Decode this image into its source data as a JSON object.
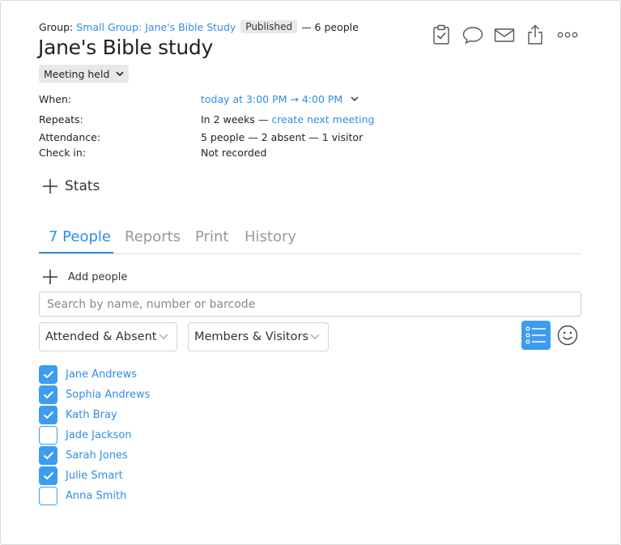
{
  "header": {
    "group_prefix": "Group:",
    "group_link": "Small Group: Jane's Bible Study",
    "status_badge": "Published",
    "people_count": "— 6 people",
    "title": "Jane's Bible study",
    "meeting_status": "Meeting held"
  },
  "toolbar": {
    "icons": [
      "clipboard-check-icon",
      "comment-icon",
      "mail-icon",
      "share-icon",
      "more-icon"
    ]
  },
  "info": {
    "when_label": "When:",
    "when_value": "today at 3:00 PM → 4:00 PM",
    "repeats_label": "Repeats:",
    "repeats_value": "In 2 weeks —",
    "repeats_link": "create next meeting",
    "attendance_label": "Attendance:",
    "attendance_value": "5 people — 2 absent — 1 visitor",
    "checkin_label": "Check in:",
    "checkin_value": "Not recorded"
  },
  "stats_label": "Stats",
  "tabs": [
    {
      "label": "7 People",
      "active": true
    },
    {
      "label": "Reports",
      "active": false
    },
    {
      "label": "Print",
      "active": false
    },
    {
      "label": "History",
      "active": false
    }
  ],
  "add_people_label": "Add people",
  "search": {
    "placeholder": "Search by name, number or barcode",
    "value": ""
  },
  "filters": {
    "attendance": "Attended & Absent",
    "membership": "Members & Visitors"
  },
  "accent_color": "#3d9bf0",
  "people": [
    {
      "name": "Jane Andrews",
      "checked": true
    },
    {
      "name": "Sophia Andrews",
      "checked": true
    },
    {
      "name": "Kath Bray",
      "checked": true
    },
    {
      "name": "Jade Jackson",
      "checked": false
    },
    {
      "name": "Sarah Jones",
      "checked": true
    },
    {
      "name": "Julie Smart",
      "checked": true
    },
    {
      "name": "Anna Smith",
      "checked": false
    }
  ]
}
